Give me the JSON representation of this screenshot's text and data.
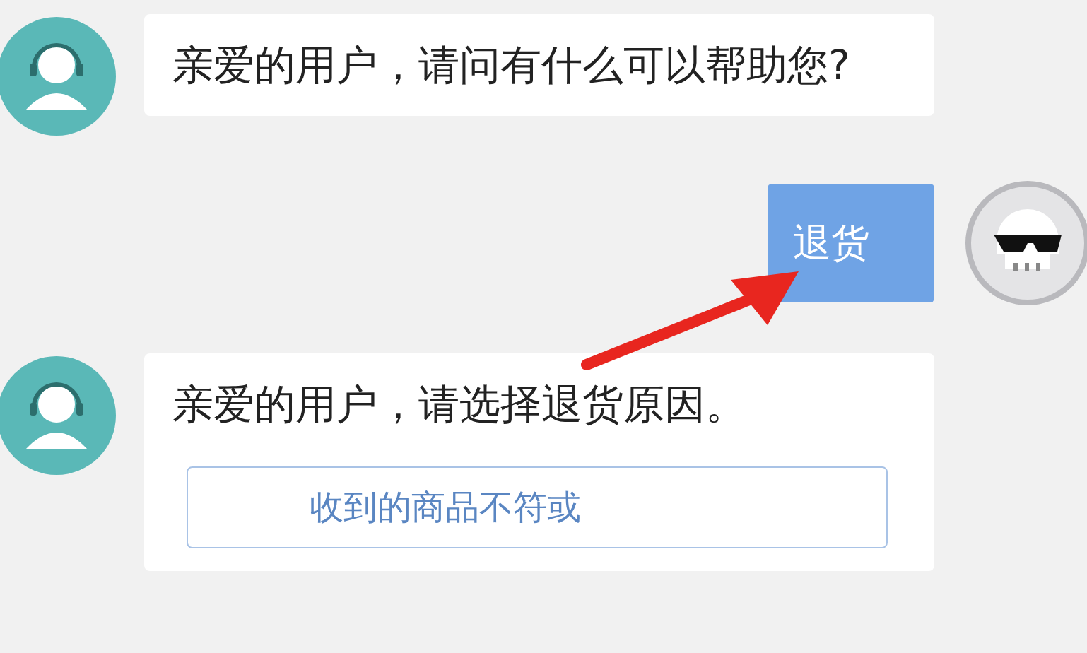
{
  "messages": [
    {
      "kind": "bot",
      "text": "亲爱的用户，请问有什么可以帮助您?"
    },
    {
      "kind": "user",
      "text": "退货"
    },
    {
      "kind": "bot",
      "text": "亲爱的用户，请选择退货原因。",
      "options": [
        "收到的商品不符或"
      ]
    }
  ]
}
